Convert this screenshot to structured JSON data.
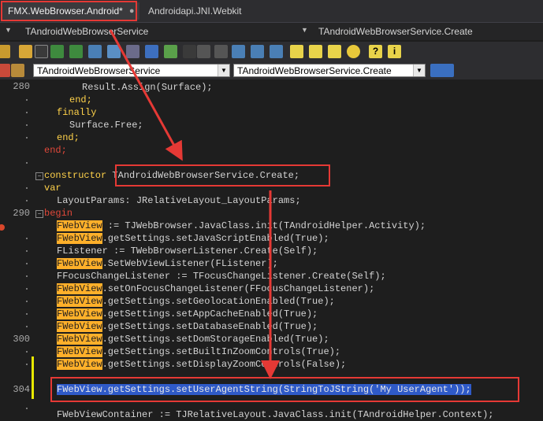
{
  "tabs": [
    {
      "label": "FMX.WebBrowser.Android*"
    },
    {
      "label": "Androidapi.JNI.Webkit"
    }
  ],
  "nav": {
    "left": "TAndroidWebBrowserService",
    "right": "TAndroidWebBrowserService.Create"
  },
  "combos": {
    "left": "TAndroidWebBrowserService",
    "right": "TAndroidWebBrowserService.Create"
  },
  "line_numbers": [
    "280",
    "290",
    "300",
    "304"
  ],
  "code": {
    "l1": "Result.Assign(Surface);",
    "l2": "end;",
    "l3": "finally",
    "l4": "Surface.Free;",
    "l5": "end;",
    "l6": "end;",
    "l7a": "constructor",
    "l7b": "TAndroidWebBrowserService.Create;",
    "l8": "var",
    "l9": "LayoutParams: JRelativeLayout_LayoutParams;",
    "l10": "begin",
    "fw": "FWebView",
    "r1": " := TJWebBrowser.JavaClass.init(TAndroidHelper.Activity);",
    "r2": ".getSettings.setJavaScriptEnabled(True);",
    "r3": "FListener := TWebBrowserListener.Create(Self);",
    "r4": ".SetWebViewListener(FListener);",
    "r5": "FFocusChangeListener := TFocusChangeListener.Create(Self);",
    "r6": ".setOnFocusChangeListener(FFocusChangeListener);",
    "r7": ".getSettings.setGeolocationEnabled(True);",
    "r8": ".getSettings.setAppCacheEnabled(True);",
    "r9": ".getSettings.setDatabaseEnabled(True);",
    "r10": ".getSettings.setDomStorageEnabled(True);",
    "r11": ".getSettings.setBuiltInZoomControls(True);",
    "r12": ".getSettings.setDisplayZoomControls(False);",
    "r13": "FWebView.getSettings.setUserAgentString(StringToJString('My UserAgent'));",
    "r14": "FWebViewContainer := TJRelativeLayout.JavaClass.init(TAndroidHelper.Context);"
  },
  "colors": {
    "annotation": "#e53935",
    "keyword": "#ffd24a",
    "highlight": "#ffb02a",
    "selection": "#2f5ac8"
  }
}
